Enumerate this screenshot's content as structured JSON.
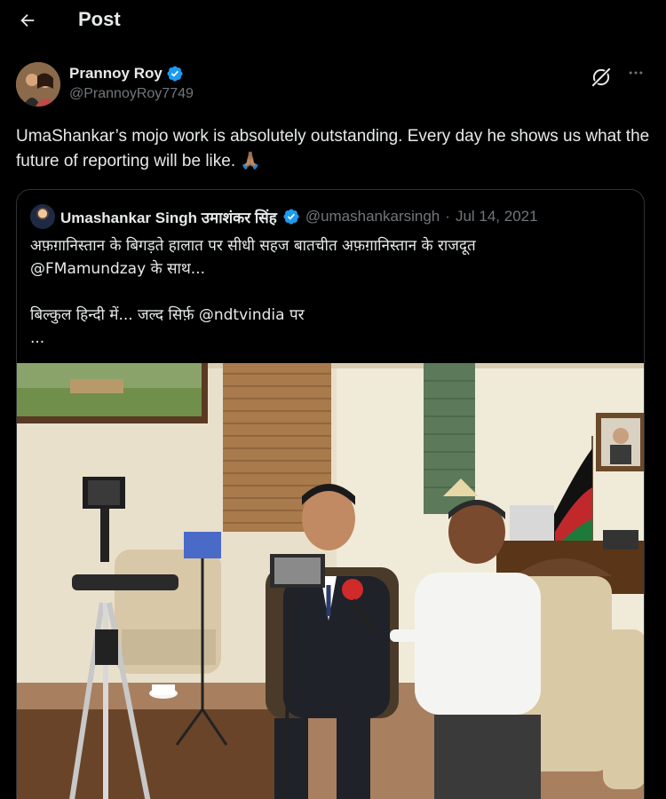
{
  "header": {
    "title": "Post"
  },
  "post": {
    "author_name": "Prannoy Roy",
    "author_handle": "@PrannoyRoy7749",
    "text": "UmaShankar’s mojo work is absolutely outstanding. Every day he shows us what the future of reporting will be like. 🙏🏽"
  },
  "quoted": {
    "author_name": "Umashankar Singh उमाशंकर सिंह",
    "author_handle": "@umashankarsingh",
    "separator": "·",
    "date": "Jul 14, 2021",
    "lines": [
      "अफ़ग़ानिस्तान के बिगड़ते हालात पर सीधी सहज बातचीत अफ़ग़ानिस्तान के राजदूत",
      "@FMamundzay के साथ...",
      "",
      "बिल्कुल हिन्दी में... जल्द सिर्फ़ @ndtvindia पर",
      "..."
    ]
  },
  "colors": {
    "verified": "#1d9bf0",
    "muted": "#71767b",
    "text": "#e7e9ea",
    "border": "#2f3336"
  },
  "icons": {
    "back": "arrow-left-icon",
    "verified": "verified-badge-icon",
    "grok": "grok-icon",
    "more": "more-horizontal-icon"
  }
}
